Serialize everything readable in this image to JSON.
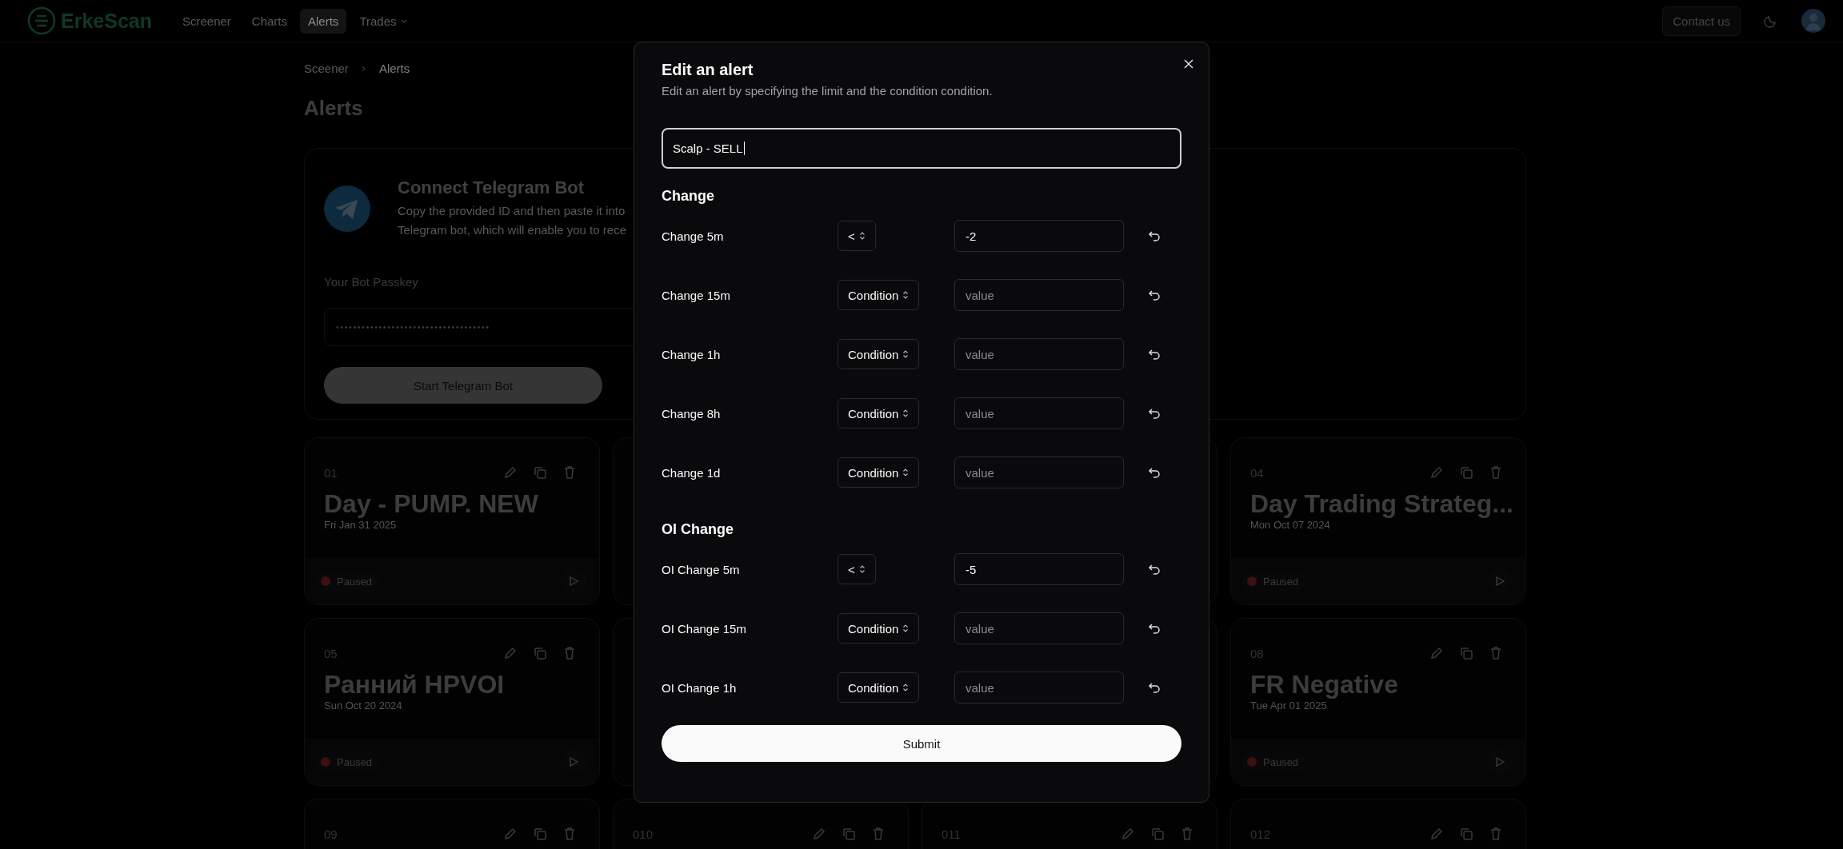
{
  "nav": {
    "logo": "ErkeScan",
    "links": [
      {
        "label": "Screener",
        "selected": false,
        "kind": "link"
      },
      {
        "label": "Charts",
        "selected": false,
        "kind": "link"
      },
      {
        "label": "Alerts",
        "selected": true,
        "kind": "link"
      },
      {
        "label": "Trades",
        "selected": false,
        "kind": "dropdown"
      }
    ],
    "contact": "Contact us"
  },
  "breadcrumb": [
    "Sceener",
    "Alerts"
  ],
  "page_title": "Alerts",
  "telegram": {
    "title": "Connect Telegram Bot",
    "description_lines": [
      "Copy the provided ID and then paste it into",
      "Telegram bot, which will enable you to rece"
    ],
    "passkey_label": "Your Bot Passkey",
    "passkey": "••••••••••••••••••••••••••••••••••••",
    "start_button": "Start Telegram Bot"
  },
  "alert_cards": [
    {
      "kind": "full",
      "number": "01",
      "title": "Day - PUMP. NEW",
      "date": "Fri Jan 31 2025",
      "status": "Paused",
      "running": false
    },
    {
      "kind": "covered"
    },
    {
      "kind": "covered"
    },
    {
      "kind": "full",
      "number": "04",
      "title": "Day Trading Strateg...",
      "date": "Mon Oct 07 2024",
      "status": "Paused",
      "running": false
    },
    {
      "kind": "full",
      "number": "05",
      "title": "Ранний HPVOI",
      "date": "Sun Oct 20 2024",
      "status": "Paused",
      "running": false
    },
    {
      "kind": "covered"
    },
    {
      "kind": "covered"
    },
    {
      "kind": "full",
      "number": "08",
      "title": "FR Negative",
      "date": "Tue Apr 01 2025",
      "status": "Paused",
      "running": false
    },
    {
      "kind": "top",
      "number": "09"
    },
    {
      "kind": "top",
      "number": "010"
    },
    {
      "kind": "top",
      "number": "011"
    },
    {
      "kind": "top",
      "number": "012"
    }
  ],
  "modal": {
    "title": "Edit an alert",
    "subtitle": "Edit an alert by specifying the limit and the condition condition.",
    "name_value": "Scalp - SELL",
    "sections": [
      {
        "title": "Change",
        "rows": [
          {
            "label": "Change 5m",
            "condition": "<",
            "value": "-2"
          },
          {
            "label": "Change 15m",
            "condition": "Condition",
            "placeholder": "value"
          },
          {
            "label": "Change 1h",
            "condition": "Condition",
            "placeholder": "value"
          },
          {
            "label": "Change 8h",
            "condition": "Condition",
            "placeholder": "value"
          },
          {
            "label": "Change 1d",
            "condition": "Condition",
            "placeholder": "value"
          }
        ]
      },
      {
        "title": "OI Change",
        "rows": [
          {
            "label": "OI Change 5m",
            "condition": "<",
            "value": "-5"
          },
          {
            "label": "OI Change 15m",
            "condition": "Condition",
            "placeholder": "value"
          },
          {
            "label": "OI Change 1h",
            "condition": "Condition",
            "placeholder": "value"
          }
        ]
      }
    ],
    "submit": "Submit"
  }
}
